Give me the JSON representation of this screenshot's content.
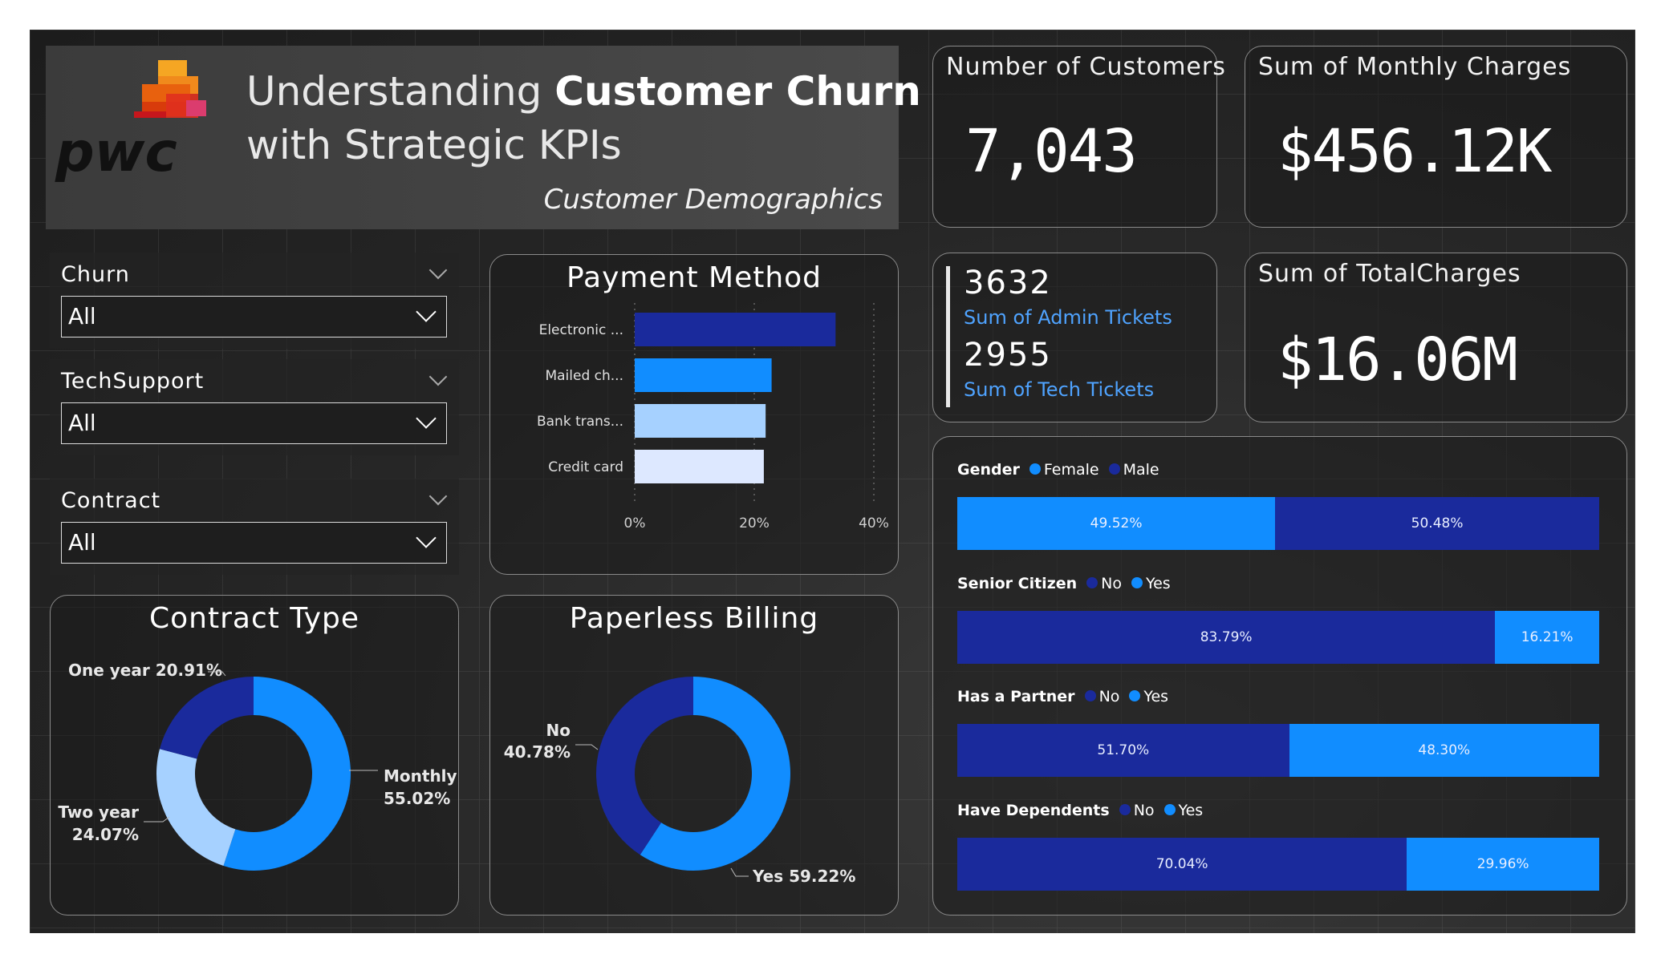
{
  "header": {
    "title_light": "Understanding ",
    "title_bold": "Customer Churn",
    "title_line2": "with Strategic KPIs",
    "subtitle": "Customer Demographics",
    "logo_text": "pwc"
  },
  "kpis": {
    "customers_label": "Number of Customers",
    "customers_value": "7,043",
    "monthly_label": "Sum of Monthly Charges",
    "monthly_value": "$456.12K",
    "admin_value": "3632",
    "admin_label": "Sum of Admin Tickets",
    "tech_value": "2955",
    "tech_label": "Sum of Tech Tickets",
    "total_label": "Sum of TotalCharges",
    "total_value": "$16.06M"
  },
  "slicers": [
    {
      "label": "Churn",
      "value": "All"
    },
    {
      "label": "TechSupport",
      "value": "All"
    },
    {
      "label": "Contract",
      "value": "All"
    }
  ],
  "colors": {
    "dark_blue": "#1a2a9c",
    "blue": "#118dff",
    "light_blue": "#a6d1ff",
    "pale_blue": "#dde8ff"
  },
  "chart_data": [
    {
      "type": "bar",
      "orientation": "horizontal",
      "title": "Payment Method",
      "categories": [
        "Electronic ...",
        "Mailed ch...",
        "Bank trans...",
        "Credit card"
      ],
      "values": [
        33.6,
        22.9,
        21.9,
        21.6
      ],
      "unit": "%",
      "xlim": [
        0,
        40
      ],
      "xticks": [
        "0%",
        "20%",
        "40%"
      ],
      "bar_colors": [
        "#1a2a9c",
        "#118dff",
        "#a6d1ff",
        "#dde8ff"
      ]
    },
    {
      "type": "pie",
      "donut": true,
      "title": "Contract Type",
      "slices": [
        {
          "label": "Monthly",
          "value": 55.02,
          "label_text": "55.02%",
          "color": "#118dff"
        },
        {
          "label": "Two year",
          "value": 24.07,
          "label_text": "24.07%",
          "color": "#a6d1ff"
        },
        {
          "label": "One year",
          "value": 20.91,
          "label_text": "20.91%",
          "color": "#1a2a9c"
        }
      ]
    },
    {
      "type": "pie",
      "donut": true,
      "title": "Paperless Billing",
      "slices": [
        {
          "label": "Yes",
          "value": 59.22,
          "label_text": "59.22%",
          "color": "#118dff"
        },
        {
          "label": "No",
          "value": 40.78,
          "label_text": "40.78%",
          "color": "#1a2a9c"
        }
      ]
    },
    {
      "type": "bar",
      "orientation": "100% stacked",
      "groups": [
        {
          "title": "Gender",
          "series": [
            {
              "name": "Female",
              "value": 49.52,
              "label": "49.52%",
              "color": "#118dff"
            },
            {
              "name": "Male",
              "value": 50.48,
              "label": "50.48%",
              "color": "#1a2a9c"
            }
          ]
        },
        {
          "title": "Senior Citizen",
          "series": [
            {
              "name": "No",
              "value": 83.79,
              "label": "83.79%",
              "color": "#1a2a9c"
            },
            {
              "name": "Yes",
              "value": 16.21,
              "label": "16.21%",
              "color": "#118dff"
            }
          ]
        },
        {
          "title": "Has a Partner",
          "series": [
            {
              "name": "No",
              "value": 51.7,
              "label": "51.70%",
              "color": "#1a2a9c"
            },
            {
              "name": "Yes",
              "value": 48.3,
              "label": "48.30%",
              "color": "#118dff"
            }
          ]
        },
        {
          "title": "Have Dependents",
          "series": [
            {
              "name": "No",
              "value": 70.04,
              "label": "70.04%",
              "color": "#1a2a9c"
            },
            {
              "name": "Yes",
              "value": 29.96,
              "label": "29.96%",
              "color": "#118dff"
            }
          ]
        }
      ]
    }
  ]
}
